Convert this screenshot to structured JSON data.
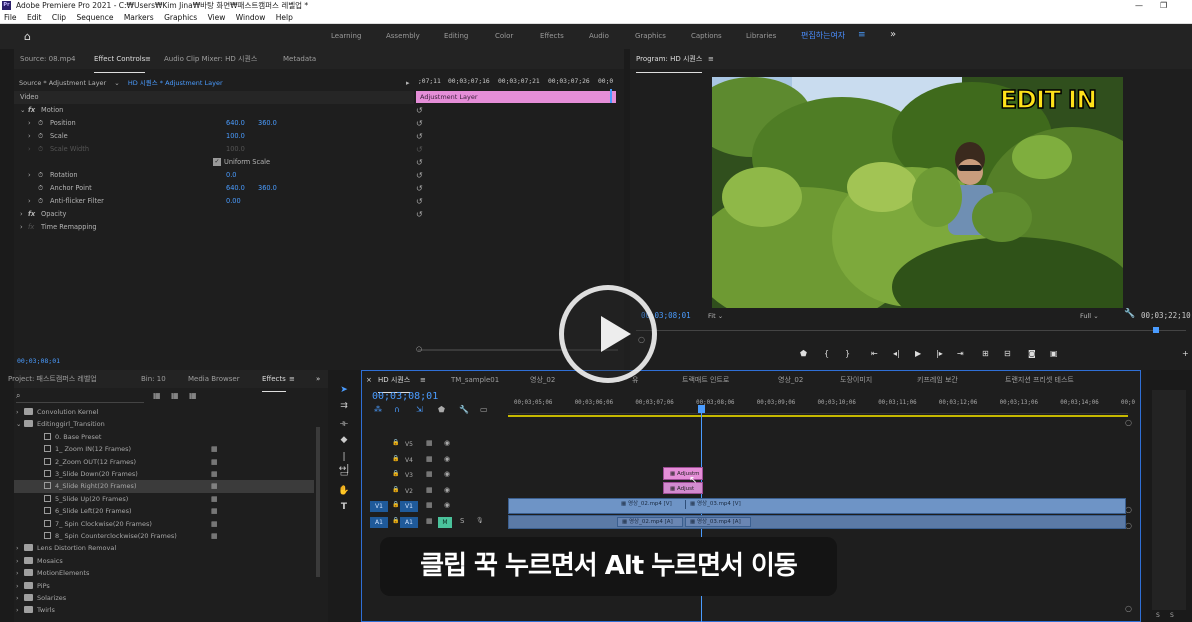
{
  "window": {
    "title": "Adobe Premiere Pro 2021 - C:₩Users₩Kim Jina₩바탕 화면₩패스트캠퍼스 레벨업 *",
    "app_icon": "Pr"
  },
  "menu": [
    "File",
    "Edit",
    "Clip",
    "Sequence",
    "Markers",
    "Graphics",
    "View",
    "Window",
    "Help"
  ],
  "workspaces": {
    "items": [
      "Learning",
      "Assembly",
      "Editing",
      "Color",
      "Effects",
      "Audio",
      "Graphics",
      "Captions",
      "Libraries"
    ],
    "active": "편집하는여자",
    "more": "»"
  },
  "effect_controls": {
    "tabs": [
      "Source: 08.mp4",
      "Effect Controls",
      "Audio Clip Mixer: HD 시퀀스",
      "Metadata"
    ],
    "source": "Source * Adjustment Layer",
    "sequence": "HD 시퀀스 * Adjustment Layer",
    "timecodes": [
      ";07;11",
      "00;03;07;16",
      "00;03;07;21",
      "00;03;07;26",
      "00;0"
    ],
    "clip_label": "Adjustment Layer",
    "video_header": "Video",
    "motion": "Motion",
    "rows": {
      "position": {
        "label": "Position",
        "x": "640.0",
        "y": "360.0"
      },
      "scale": {
        "label": "Scale",
        "value": "100.0"
      },
      "scale_width": {
        "label": "Scale Width",
        "value": "100.0"
      },
      "uniform_scale": "Uniform Scale",
      "rotation": {
        "label": "Rotation",
        "value": "0.0"
      },
      "anchor": {
        "label": "Anchor Point",
        "x": "640.0",
        "y": "360.0"
      },
      "antiflicker": {
        "label": "Anti-flicker Filter",
        "value": "0.00"
      }
    },
    "opacity": "Opacity",
    "time_remapping": "Time Remapping",
    "current_time": "00;03;08;01"
  },
  "program": {
    "title": "Program: HD 시퀀스",
    "overlay_text": "EDIT IN",
    "timecode": "00;03;08;01",
    "fit": "Fit",
    "quality": "Full",
    "duration": "00;03;22;10"
  },
  "project": {
    "tabs": [
      "Project: 패스트캠퍼스 레벨업",
      "Bin: 10",
      "Media Browser",
      "Effects"
    ],
    "search_placeholder": "",
    "items": [
      {
        "name": "Convolution Kernel",
        "type": "folder",
        "indent": 1
      },
      {
        "name": "Editinggirl_Transition",
        "type": "folder",
        "indent": 1,
        "open": true
      },
      {
        "name": "0. Base Preset",
        "type": "preset",
        "indent": 2
      },
      {
        "name": "1_ Zoom IN(12 Frames)",
        "type": "preset",
        "indent": 2,
        "accel": true
      },
      {
        "name": "2_Zoom OUT(12 Frames)",
        "type": "preset",
        "indent": 2,
        "accel": true
      },
      {
        "name": "3_Slide Down(20 Frames)",
        "type": "preset",
        "indent": 2,
        "accel": true
      },
      {
        "name": "4_Slide Right(20 Frames)",
        "type": "preset",
        "indent": 2,
        "accel": true,
        "selected": true
      },
      {
        "name": "5_Slide Up(20 Frames)",
        "type": "preset",
        "indent": 2,
        "accel": true
      },
      {
        "name": "6_Slide Left(20 Frames)",
        "type": "preset",
        "indent": 2,
        "accel": true
      },
      {
        "name": "7_ Spin Clockwise(20 Frames)",
        "type": "preset",
        "indent": 2,
        "accel": true
      },
      {
        "name": "8_ Spin Counterclockwise(20 Frames)",
        "type": "preset",
        "indent": 2,
        "accel": true
      },
      {
        "name": "Lens Distortion Removal",
        "type": "folder",
        "indent": 1
      },
      {
        "name": "Mosaics",
        "type": "folder",
        "indent": 1
      },
      {
        "name": "MotionElements",
        "type": "folder",
        "indent": 1
      },
      {
        "name": "PiPs",
        "type": "folder",
        "indent": 1
      },
      {
        "name": "Solarizes",
        "type": "folder",
        "indent": 1
      },
      {
        "name": "Twirls",
        "type": "folder",
        "indent": 1
      }
    ]
  },
  "timeline": {
    "tabs": [
      "HD 시퀀스",
      "TM_sample01",
      "영상_02",
      "유",
      "트랙매트 인트로",
      "영상_02",
      "도장이미지",
      "키프레임 보간",
      "트랜지션 프리셋 테스트"
    ],
    "timecode": "00;03;08;01",
    "ruler": [
      "00;03;05;06",
      "00;03;06;06",
      "00;03;07;06",
      "00;03;08;06",
      "00;03;09;06",
      "00;03;10;06",
      "00;03;11;06",
      "00;03;12;06",
      "00;03;13;06",
      "00;03;14;06",
      "00;0"
    ],
    "tracks": [
      "V5",
      "V4",
      "V3",
      "V2",
      "V1",
      "A1"
    ],
    "v1_src": "V1",
    "a1_src": "A1",
    "mute": "M",
    "solo": "S",
    "adj_clip_1": "Adjustm",
    "adj_clip_2": "Adjust",
    "v1_clips": [
      "영상_02.mp4 [V]",
      "영상_03.mp4 [V]"
    ],
    "a1_clips": [
      "영상_02.mp4 [A]",
      "영상_03.mp4 [A]"
    ]
  },
  "subtitle": "클립 꾹 누르면서 Alt 누르면서 이동",
  "audio_meter": {
    "s1": "S",
    "s2": "S"
  },
  "colors": {
    "accent_blue": "#4a9cff",
    "clip_pink": "#e58ed8",
    "clip_blue": "#6e94c6",
    "track_green": "#4ac29b"
  }
}
